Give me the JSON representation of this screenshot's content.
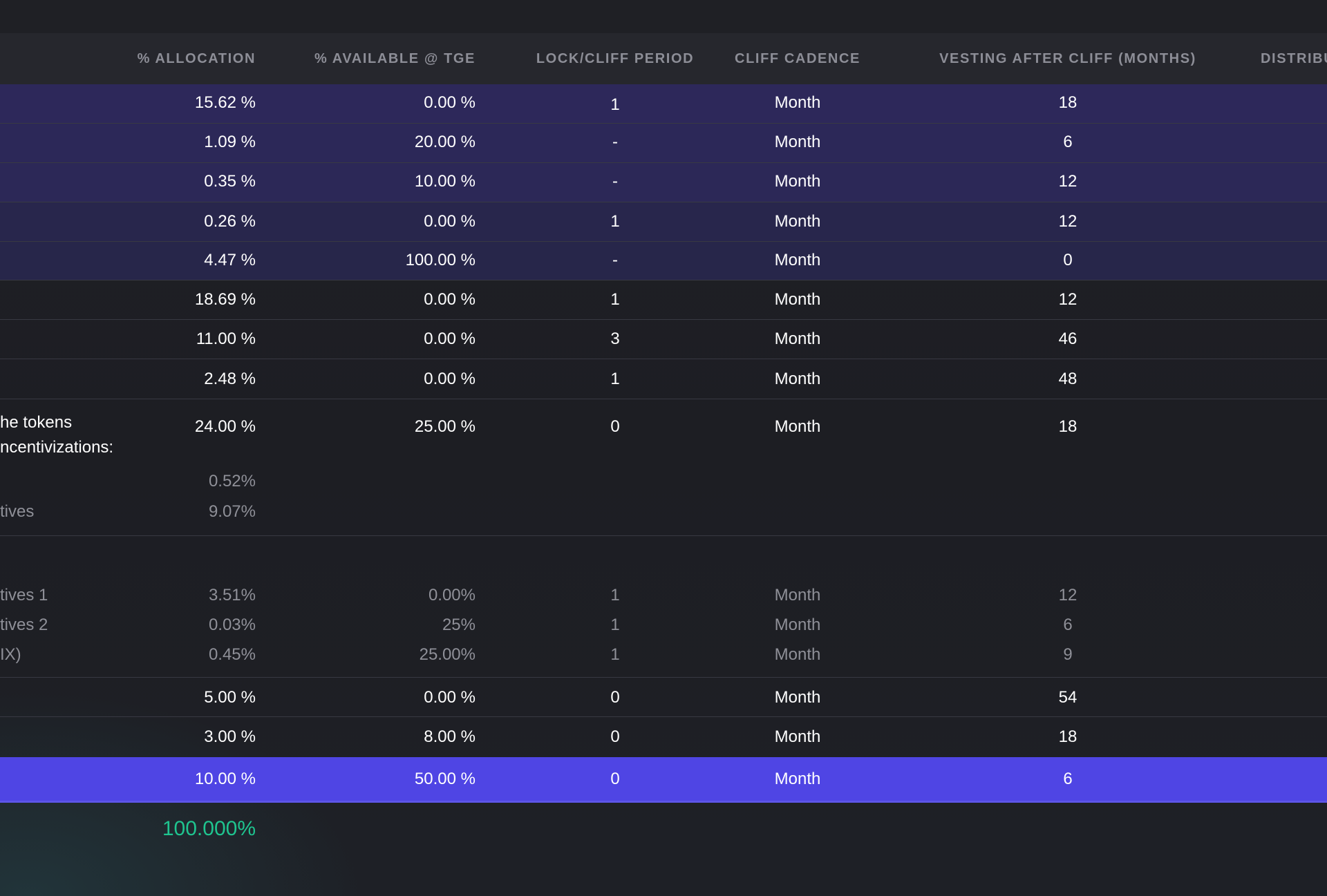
{
  "header": {
    "allocation": "% ALLOCATION",
    "available_tge": "% AVAILABLE @ TGE",
    "lock_cliff": "LOCK/CLIFF PERIOD",
    "cliff_cadence": "CLIFF CADENCE",
    "vesting_after_cliff": "VESTING AFTER CLIFF (MONTHS)",
    "distribution": "DISTRIBU"
  },
  "colors": {
    "highlight_row": "#4f45e4",
    "total_text": "#1fc48f",
    "purple_rows": "#2e2a5a"
  },
  "rows": [
    {
      "allocation": "15.62 %",
      "tge": "0.00 %",
      "cliff": "1",
      "cadence": "Month",
      "vesting": "18"
    },
    {
      "allocation": "1.09  %",
      "tge": "20.00 %",
      "cliff": "-",
      "cadence": "Month",
      "vesting": "6"
    },
    {
      "allocation": "0.35 %",
      "tge": "10.00 %",
      "cliff": "-",
      "cadence": "Month",
      "vesting": "12"
    },
    {
      "allocation": "0.26 %",
      "tge": "0.00 %",
      "cliff": "1",
      "cadence": "Month",
      "vesting": "12"
    },
    {
      "allocation": "4.47 %",
      "tge": "100.00 %",
      "cliff": "-",
      "cadence": "Month",
      "vesting": "0"
    },
    {
      "allocation": "18.69 %",
      "tge": "0.00 %",
      "cliff": "1",
      "cadence": "Month",
      "vesting": "12"
    },
    {
      "allocation": "11.00 %",
      "tge": "0.00 %",
      "cliff": "3",
      "cadence": "Month",
      "vesting": "46"
    },
    {
      "allocation": "2.48 %",
      "tge": "0.00 %",
      "cliff": "1",
      "cadence": "Month",
      "vesting": "48"
    },
    {
      "name_line1": "he tokens",
      "name_line2": "ncentivizations:",
      "allocation": "24.00 %",
      "tge": "25.00 %",
      "cliff": "0",
      "cadence": "Month",
      "vesting": "18"
    }
  ],
  "sub_rows_a": [
    {
      "name": "",
      "allocation": "0.52%"
    },
    {
      "name": "tives",
      "allocation": "9.07%"
    }
  ],
  "sub_rows_b": [
    {
      "name": "tives 1",
      "allocation": "3.51%",
      "tge": "0.00%",
      "cliff": "1",
      "cadence": "Month",
      "vesting": "12"
    },
    {
      "name": "tives 2",
      "allocation": "0.03%",
      "tge": "25%",
      "cliff": "1",
      "cadence": "Month",
      "vesting": "6"
    },
    {
      "name": "IX)",
      "allocation": "0.45%",
      "tge": "25.00%",
      "cliff": "1",
      "cadence": "Month",
      "vesting": "9"
    }
  ],
  "rows_after": [
    {
      "allocation": "5.00 %",
      "tge": "0.00 %",
      "cliff": "0",
      "cadence": "Month",
      "vesting": "54"
    },
    {
      "allocation": "3.00 %",
      "tge": "8.00 %",
      "cliff": "0",
      "cadence": "Month",
      "vesting": "18"
    }
  ],
  "highlight_row": {
    "allocation": "10.00 %",
    "tge": "50.00 %",
    "cliff": "0",
    "cadence": "Month",
    "vesting": "6"
  },
  "total": "100.000%"
}
